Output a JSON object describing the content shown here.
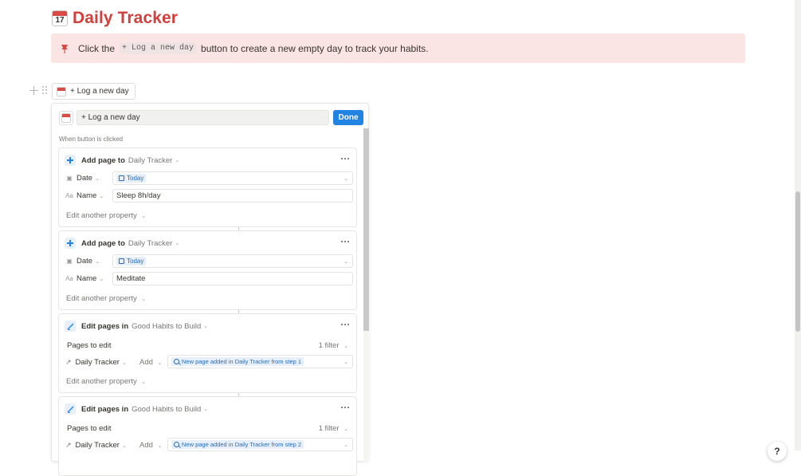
{
  "page": {
    "title": "Daily Tracker",
    "title_icon": "calendar-icon"
  },
  "callout": {
    "icon": "pin-icon",
    "text_before": "Click the",
    "code": "+ Log a new day",
    "text_after": "button to create a new empty day to track your habits."
  },
  "button_block": {
    "label": "+ Log a new day"
  },
  "editor": {
    "name_value": "+ Log a new day",
    "done_label": "Done",
    "trigger_label": "When button is clicked",
    "steps": [
      {
        "action": "Add page to",
        "target": "Daily Tracker",
        "props": [
          {
            "name": "Date",
            "icon": "calendar-prop-icon",
            "value": "Today",
            "type": "date"
          },
          {
            "name": "Name",
            "icon": "text-prop-icon",
            "value": "Sleep 8h/day",
            "type": "text"
          }
        ],
        "edit_another": "Edit another property"
      },
      {
        "action": "Add page to",
        "target": "Daily Tracker",
        "props": [
          {
            "name": "Date",
            "icon": "calendar-prop-icon",
            "value": "Today",
            "type": "date"
          },
          {
            "name": "Name",
            "icon": "text-prop-icon",
            "value": "Meditate",
            "type": "text"
          }
        ],
        "edit_another": "Edit another property"
      },
      {
        "action": "Edit pages in",
        "target": "Good Habits to Build",
        "pages_to_edit": "Pages to edit",
        "filter": "1 filter",
        "relation": "Daily Tracker",
        "add": "Add",
        "chip": "New page added in Daily Tracker from step 1",
        "edit_another": "Edit another property"
      },
      {
        "action": "Edit pages in",
        "target": "Good Habits to Build",
        "pages_to_edit": "Pages to edit",
        "filter": "1 filter",
        "relation": "Daily Tracker",
        "add": "Add",
        "chip": "New page added in Daily Tracker from step 2"
      }
    ]
  },
  "help": {
    "label": "?"
  },
  "colors": {
    "title": "#d1403d",
    "callout_bg": "#fbe4e4",
    "accent": "#2383e2",
    "chip_bg": "#e7f0fa"
  }
}
